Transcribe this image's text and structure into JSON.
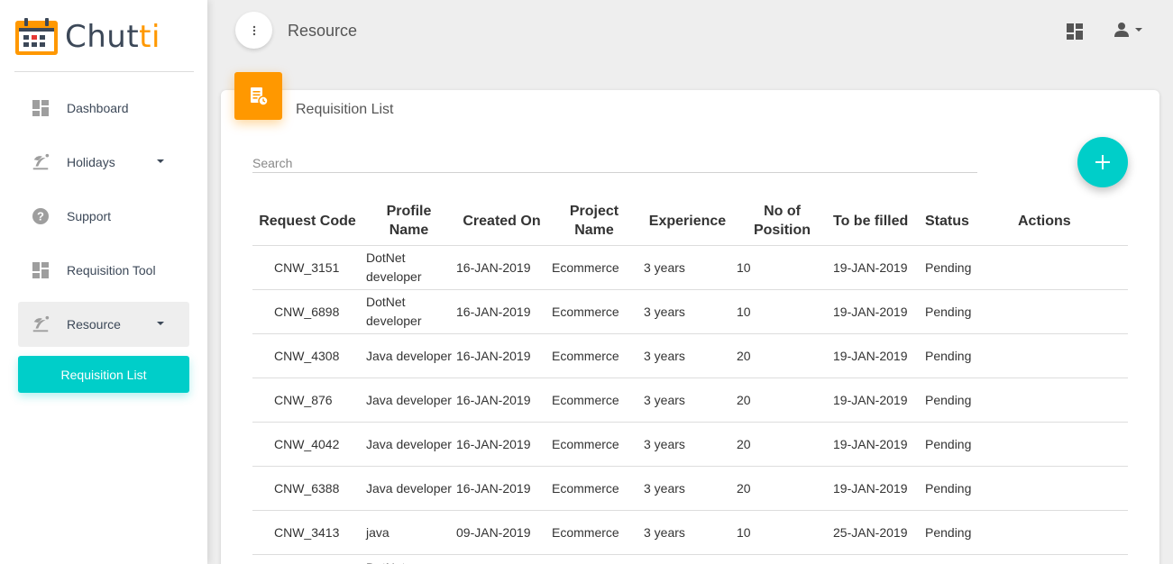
{
  "brand": {
    "name_main": "Chut",
    "name_accent": "ti"
  },
  "sidebar": {
    "items": [
      {
        "label": "Dashboard",
        "icon": "dashboard-icon"
      },
      {
        "label": "Holidays",
        "icon": "beach-icon",
        "has_caret": true
      },
      {
        "label": "Support",
        "icon": "help-icon"
      },
      {
        "label": "Requisition Tool",
        "icon": "dashboard-icon"
      },
      {
        "label": "Resource",
        "icon": "beach-icon",
        "has_caret": true,
        "active": true
      }
    ],
    "sub_item": {
      "label": "Requisition List"
    }
  },
  "header": {
    "title": "Resource"
  },
  "card": {
    "title": "Requisition List",
    "icon": "requisition-icon"
  },
  "search": {
    "placeholder": "Search"
  },
  "table": {
    "columns": [
      "Request Code",
      "Profile Name",
      "Created On",
      "Project Name",
      "Experience",
      "No of Position",
      "To be filled",
      "Status",
      "Actions"
    ],
    "rows": [
      [
        "CNW_3151",
        "DotNet developer",
        "16-JAN-2019",
        "Ecommerce",
        "3 years",
        "10",
        "19-JAN-2019",
        "Pending",
        ""
      ],
      [
        "CNW_6898",
        "DotNet developer",
        "16-JAN-2019",
        "Ecommerce",
        "3 years",
        "10",
        "19-JAN-2019",
        "Pending",
        ""
      ],
      [
        "CNW_4308",
        "Java developer",
        "16-JAN-2019",
        "Ecommerce",
        "3 years",
        "20",
        "19-JAN-2019",
        "Pending",
        ""
      ],
      [
        "CNW_876",
        "Java developer",
        "16-JAN-2019",
        "Ecommerce",
        "3 years",
        "20",
        "19-JAN-2019",
        "Pending",
        ""
      ],
      [
        "CNW_4042",
        "Java developer",
        "16-JAN-2019",
        "Ecommerce",
        "3 years",
        "20",
        "19-JAN-2019",
        "Pending",
        ""
      ],
      [
        "CNW_6388",
        "Java developer",
        "16-JAN-2019",
        "Ecommerce",
        "3 years",
        "20",
        "19-JAN-2019",
        "Pending",
        ""
      ],
      [
        "CNW_3413",
        "java",
        "09-JAN-2019",
        "Ecommerce",
        "3 years",
        "10",
        "25-JAN-2019",
        "Pending",
        ""
      ],
      [
        "",
        "DotNet",
        "",
        "",
        "",
        "",
        "",
        "",
        ""
      ]
    ]
  },
  "colors": {
    "accent": "#00cec9",
    "brand_orange": "#ff9800",
    "text": "#3c4858"
  }
}
